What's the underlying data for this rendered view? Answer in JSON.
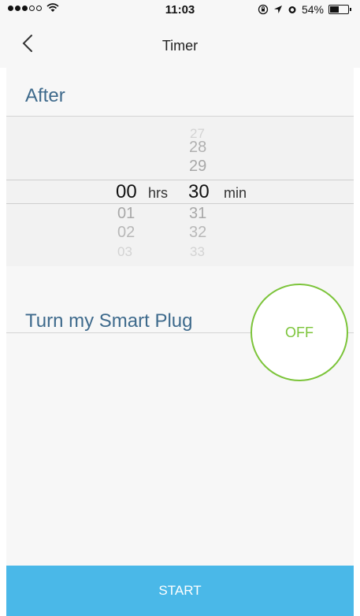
{
  "status_bar": {
    "time": "11:03",
    "battery_percent_label": "54%",
    "battery_level": 0.54,
    "signal_bars_filled": 3,
    "signal_bars_total": 5,
    "icons": [
      "wifi-icon",
      "rotation-lock-icon",
      "location-icon",
      "alarm-icon",
      "battery-icon"
    ]
  },
  "nav": {
    "title": "Timer",
    "back_icon": "chevron-left-icon"
  },
  "after_section": {
    "heading": "After"
  },
  "picker": {
    "hours": {
      "above": [],
      "selected": "00",
      "below": [
        "01",
        "02",
        "03"
      ],
      "unit": "hrs"
    },
    "minutes": {
      "above": [
        "27",
        "28",
        "29"
      ],
      "selected": "30",
      "below": [
        "31",
        "32",
        "33"
      ],
      "unit": "min"
    }
  },
  "plug_section": {
    "heading": "Turn my Smart Plug",
    "toggle_label": "OFF"
  },
  "footer": {
    "start_label": "START"
  },
  "colors": {
    "accent_blue": "#4ab8e8",
    "heading_blue": "#3e6a8c",
    "toggle_green": "#7cc43a"
  }
}
